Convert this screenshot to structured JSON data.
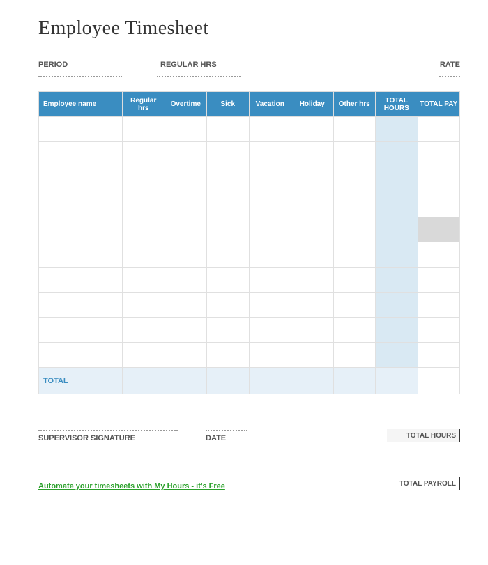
{
  "title": "Employee Timesheet",
  "meta": {
    "period_label": "PERIOD",
    "regular_label": "REGULAR HRS",
    "rate_label": "RATE"
  },
  "table": {
    "headers": {
      "employee": "Employee name",
      "regular": "Regular hrs",
      "overtime": "Overtime",
      "sick": "Sick",
      "vacation": "Vacation",
      "holiday": "Holiday",
      "other": "Other hrs",
      "total_hours": "TOTAL HOURS",
      "total_pay": "TOTAL PAY"
    },
    "rows": [
      {
        "emp": "",
        "reg": "",
        "ot": "",
        "sick": "",
        "vac": "",
        "hol": "",
        "other": "",
        "th": "",
        "tp": ""
      },
      {
        "emp": "",
        "reg": "",
        "ot": "",
        "sick": "",
        "vac": "",
        "hol": "",
        "other": "",
        "th": "",
        "tp": ""
      },
      {
        "emp": "",
        "reg": "",
        "ot": "",
        "sick": "",
        "vac": "",
        "hol": "",
        "other": "",
        "th": "",
        "tp": ""
      },
      {
        "emp": "",
        "reg": "",
        "ot": "",
        "sick": "",
        "vac": "",
        "hol": "",
        "other": "",
        "th": "",
        "tp": ""
      },
      {
        "emp": "",
        "reg": "",
        "ot": "",
        "sick": "",
        "vac": "",
        "hol": "",
        "other": "",
        "th": "",
        "tp": ""
      },
      {
        "emp": "",
        "reg": "",
        "ot": "",
        "sick": "",
        "vac": "",
        "hol": "",
        "other": "",
        "th": "",
        "tp": ""
      },
      {
        "emp": "",
        "reg": "",
        "ot": "",
        "sick": "",
        "vac": "",
        "hol": "",
        "other": "",
        "th": "",
        "tp": ""
      },
      {
        "emp": "",
        "reg": "",
        "ot": "",
        "sick": "",
        "vac": "",
        "hol": "",
        "other": "",
        "th": "",
        "tp": ""
      },
      {
        "emp": "",
        "reg": "",
        "ot": "",
        "sick": "",
        "vac": "",
        "hol": "",
        "other": "",
        "th": "",
        "tp": ""
      },
      {
        "emp": "",
        "reg": "",
        "ot": "",
        "sick": "",
        "vac": "",
        "hol": "",
        "other": "",
        "th": "",
        "tp": ""
      }
    ],
    "total_label": "TOTAL"
  },
  "signatures": {
    "supervisor_label": "SUPERVISOR SIGNATURE",
    "date_label": "DATE",
    "total_hours_label": "TOTAL HOURS",
    "total_payroll_label": "TOTAL PAYROLL"
  },
  "promo": {
    "text": "Automate your timesheets with My Hours - it's Free"
  }
}
